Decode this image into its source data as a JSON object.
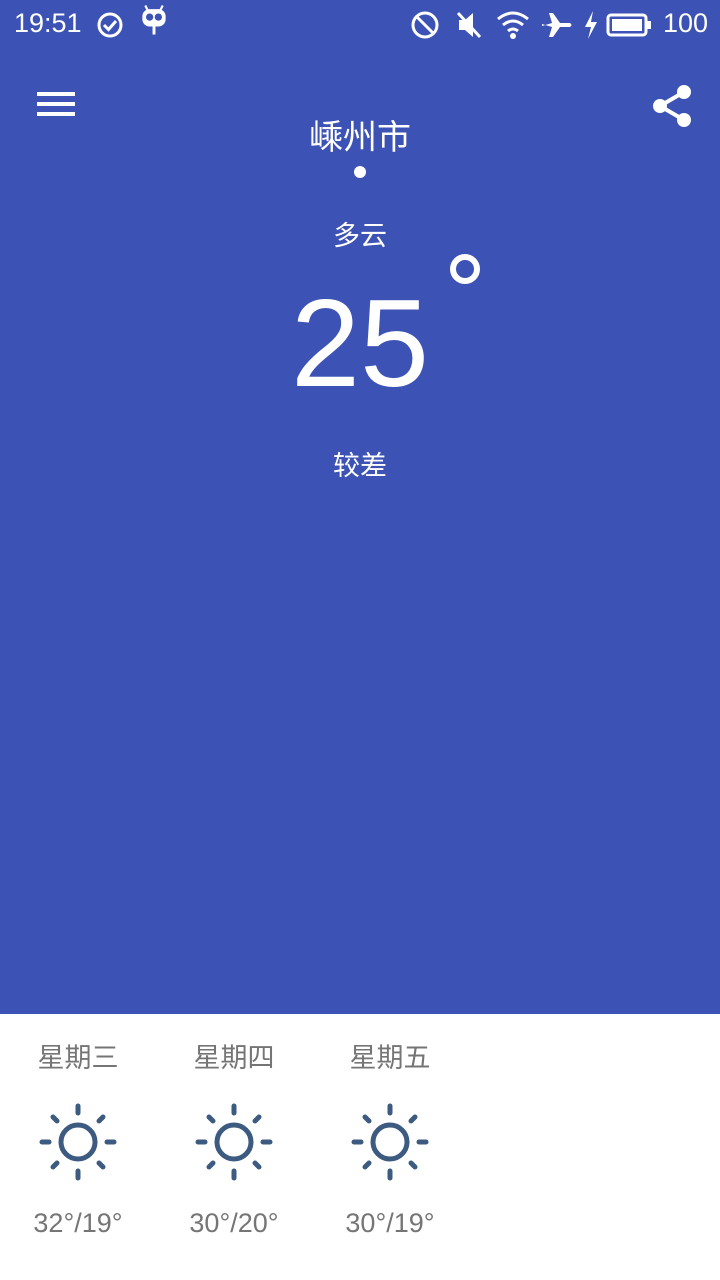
{
  "status_bar": {
    "time": "19:51",
    "battery_percent": "100",
    "icons": [
      "check-circle-icon",
      "android-mascot-icon",
      "do-not-disturb-icon",
      "mute-icon",
      "wifi-icon",
      "airplane-icon",
      "charging-icon",
      "battery-icon"
    ]
  },
  "header": {
    "city": "嵊州市",
    "menu_icon": "menu-icon",
    "share_icon": "share-icon"
  },
  "current": {
    "condition": "多云",
    "temperature": "25",
    "air_quality": "较差"
  },
  "forecast": [
    {
      "day": "星期三",
      "icon": "sun-icon",
      "range": "32°/19°"
    },
    {
      "day": "星期四",
      "icon": "sun-icon",
      "range": "30°/20°"
    },
    {
      "day": "星期五",
      "icon": "sun-icon",
      "range": "30°/19°"
    }
  ],
  "colors": {
    "primary": "#3c52b5",
    "forecast_text": "#757575",
    "sun_icon": "#3d5a80"
  }
}
